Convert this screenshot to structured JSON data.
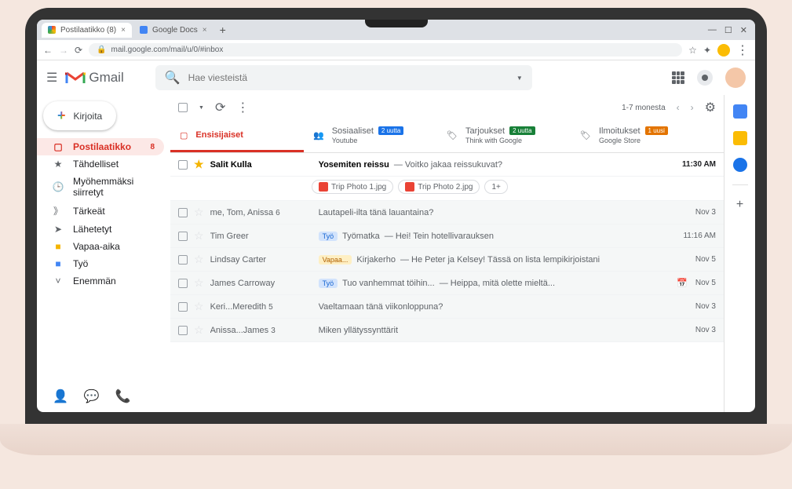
{
  "browser": {
    "tabs": [
      {
        "title": "Postilaatikko (8)",
        "active": true
      },
      {
        "title": "Google Docs",
        "active": false
      }
    ],
    "url": "mail.google.com/mail/u/0/#inbox"
  },
  "header": {
    "product": "Gmail",
    "search_placeholder": "Hae viesteistä"
  },
  "compose": {
    "label": "Kirjoita"
  },
  "sidebar": {
    "items": [
      {
        "icon": "inbox",
        "label": "Postilaatikko",
        "active": true,
        "badge": "8"
      },
      {
        "icon": "star",
        "label": "Tähdelliset"
      },
      {
        "icon": "clock",
        "label": "Myöhemmäksi siirretyt"
      },
      {
        "icon": "important",
        "label": "Tärkeät"
      },
      {
        "icon": "send",
        "label": "Lähetetyt"
      },
      {
        "icon": "folder-yellow",
        "label": "Vapaa-aika"
      },
      {
        "icon": "folder-blue",
        "label": "Työ"
      },
      {
        "icon": "more",
        "label": "Enemmän"
      }
    ]
  },
  "toolbar": {
    "page_info": "1-7 monesta"
  },
  "categories": [
    {
      "icon": "inbox",
      "label": "Ensisijaiset",
      "active": true
    },
    {
      "icon": "people",
      "label": "Sosiaaliset",
      "badge": "2 uutta",
      "badgeClass": "blue",
      "sub": "Youtube"
    },
    {
      "icon": "tag",
      "label": "Tarjoukset",
      "badge": "2 uutta",
      "badgeClass": "green",
      "sub": "Think with Google"
    },
    {
      "icon": "tag",
      "label": "Ilmoitukset",
      "badge": "1 uusi",
      "badgeClass": "orange",
      "sub": "Google Store"
    }
  ],
  "emails": [
    {
      "unread": true,
      "starred": true,
      "sender": "Salit Kulla",
      "subject": "Yosemiten reissu",
      "snippet": "Voitko jakaa reissukuvat?",
      "time": "11:30 AM",
      "attachments": [
        {
          "name": "Trip Photo 1.jpg"
        },
        {
          "name": "Trip Photo 2.jpg"
        },
        {
          "name": "1+"
        }
      ]
    },
    {
      "unread": false,
      "sender": "me, Tom, Anissa",
      "count": "6",
      "subject": "Lautapeli-ilta tänä lauantaina?",
      "time": "Nov 3"
    },
    {
      "unread": false,
      "sender": "Tim Greer",
      "labelChip": "Työ",
      "labelClass": "tyo",
      "subject": "Työmatka",
      "snippet": "Hei! Tein hotellivarauksen",
      "time": "11:16 AM"
    },
    {
      "unread": false,
      "sender": "Lindsay Carter",
      "labelChip": "Vapaa...",
      "labelClass": "vapaa",
      "subject": "Kirjakerho",
      "snippet": "He Peter ja Kelsey! Tässä on lista lempikirjoistani",
      "time": "Nov 5"
    },
    {
      "unread": false,
      "sender": "James Carroway",
      "labelChip": "Työ",
      "labelClass": "tyo",
      "subject": "Tuo vanhemmat töihin...",
      "snippet": "Heippa, mitä olette mieltä...",
      "time": "Nov 5",
      "hasCal": true
    },
    {
      "unread": false,
      "sender": "Keri...Meredith",
      "count": "5",
      "subject": "Vaeltamaan tänä viikonloppuna?",
      "time": "Nov 3"
    },
    {
      "unread": false,
      "sender": "Anissa...James",
      "count": "3",
      "subject": "Miken yllätyssynttärit",
      "time": "Nov 3"
    }
  ]
}
